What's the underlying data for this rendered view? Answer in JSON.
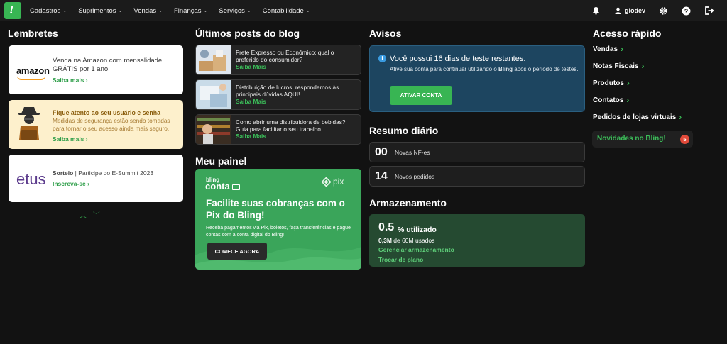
{
  "nav": {
    "items": [
      "Cadastros",
      "Suprimentos",
      "Vendas",
      "Finanças",
      "Serviços",
      "Contabilidade"
    ],
    "user": "giodev"
  },
  "reminders": {
    "title": "Lembretes",
    "amazon": {
      "logo": "amazon",
      "text": "Venda na Amazon com mensalidade GRÁTIS por 1 ano!",
      "link": "Saiba mais"
    },
    "security": {
      "heading": "Fique atento ao seu usuário e senha",
      "text": "Medidas de segurança estão sendo tomadas para tornar o seu acesso ainda mais seguro.",
      "link": "Saiba mais"
    },
    "etus": {
      "logo": "etus",
      "title": "Sorteio",
      "sep": " | ",
      "text": "Participe do E-Summit 2023",
      "link": "Inscreva-se"
    }
  },
  "blog": {
    "title": "Últimos posts do blog",
    "posts": [
      {
        "title": "Frete Expresso ou Econômico: qual o preferido do consumidor?",
        "link": "Saiba Mais"
      },
      {
        "title": "Distribuição de lucros: respondemos às principais dúvidas AQUI!",
        "link": "Saiba Mais"
      },
      {
        "title": "Como abrir uma distribuidora de bebidas? Guia para facilitar o seu trabalho",
        "link": "Saiba Mais"
      }
    ]
  },
  "panel": {
    "title": "Meu painel",
    "brand_top": "bling",
    "brand_main": "conta",
    "pix": "pix",
    "headline": "Facilite suas cobranças com o Pix do Bling!",
    "desc": "Receba pagamentos via Pix, boletos, faça transferências e pague contas com a conta digital do Bling!",
    "button": "COMECE AGORA"
  },
  "notices": {
    "title": "Avisos",
    "heading": "Você possui 16 dias de teste restantes.",
    "desc_pre": "Ative sua conta para continuar utilizando o ",
    "desc_brand": "Bling",
    "desc_post": " após o período de testes.",
    "button": "ATIVAR CONTA"
  },
  "daily": {
    "title": "Resumo diário",
    "items": [
      {
        "num": "00",
        "label": "Novas NF-es"
      },
      {
        "num": "14",
        "label": "Novos pedidos"
      }
    ]
  },
  "storage": {
    "title": "Armazenamento",
    "percent": "0.5",
    "percent_label": "% utilizado",
    "used": "0,3M",
    "used_rest": " de 60M usados",
    "link1": "Gerenciar armazenamento",
    "link2": "Trocar de plano"
  },
  "quick": {
    "title": "Acesso rápido",
    "items": [
      "Vendas",
      "Notas Fiscais",
      "Produtos",
      "Contatos",
      "Pedidos de lojas virtuais"
    ],
    "news": "Novidades no Bling!",
    "news_count": "5"
  },
  "colors": {
    "accent": "#38b553",
    "background": "#121212",
    "notice": "#1d4560"
  }
}
